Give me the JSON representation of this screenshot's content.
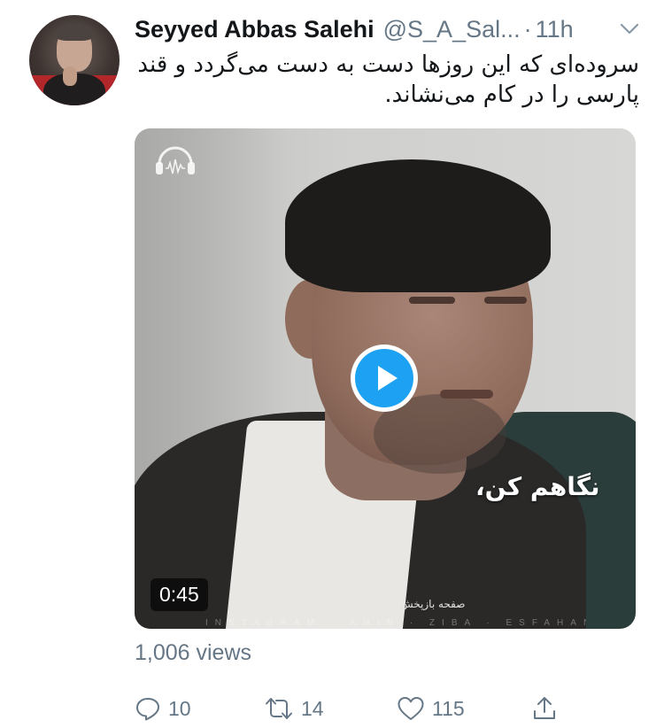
{
  "author": {
    "name": "Seyyed Abbas Salehi",
    "handle": "@S_A_Sal...",
    "separator": "·",
    "time": "11h"
  },
  "icons": {
    "avatar": "profile-photo",
    "menu": "chevron-down-icon",
    "play": "play-icon",
    "reply": "reply-icon",
    "retweet": "retweet-icon",
    "like": "heart-icon",
    "share": "share-icon"
  },
  "tweet": {
    "text": "سروده‌ای که این روزها دست به دست می‌گردد و قند پارسی را در کام می‌نشاند."
  },
  "media": {
    "caption": "نگاهم کن،",
    "duration": "0:45",
    "small_watermark": "صفحه بازپخش",
    "bottom_watermark": "INSTAGRAM · AMIN · ZIBA · ESFAHANI"
  },
  "stats": {
    "views": "1,006 views",
    "replies": "10",
    "retweets": "14",
    "likes": "115"
  },
  "colors": {
    "accent": "#1da1f2",
    "muted": "#657786",
    "text": "#14171a"
  }
}
